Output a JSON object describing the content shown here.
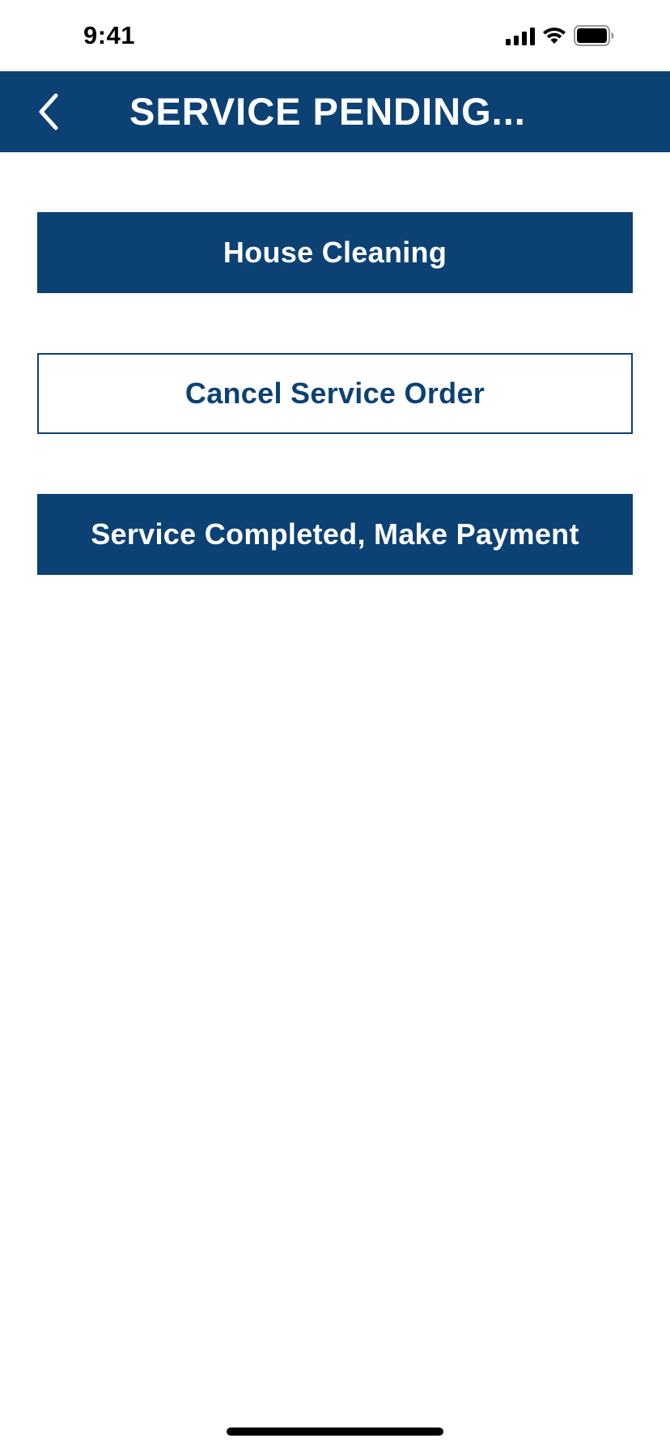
{
  "status_bar": {
    "time": "9:41",
    "icons": [
      "signal-icon",
      "wifi-icon",
      "battery-icon"
    ]
  },
  "header": {
    "back_icon": "chevron-left-icon",
    "title": "SERVICE PENDING..."
  },
  "buttons": {
    "service": "House Cleaning",
    "cancel": "Cancel Service Order",
    "complete": "Service Completed, Make Payment"
  },
  "colors": {
    "primary": "#0c4174",
    "background": "#ffffff",
    "on_primary": "#ffffff"
  }
}
